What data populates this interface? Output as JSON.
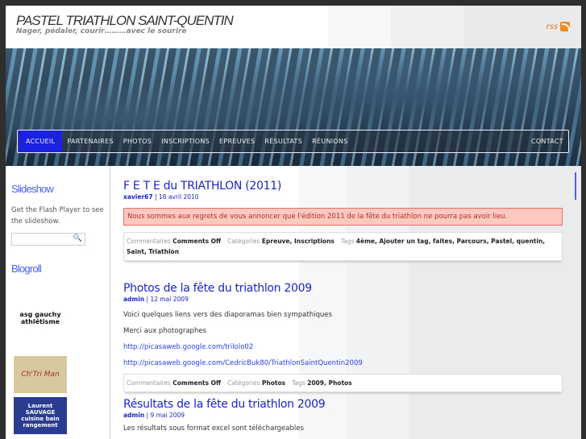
{
  "header": {
    "title": "PASTEL TRIATHLON SAINT-QUENTIN",
    "tagline": "Nager, pédaler, courir………avec le sourire",
    "rss": "rss"
  },
  "nav": [
    "ACCUEIL",
    "PARTENAIRES",
    "PHOTOS",
    "INSCRIPTIONS",
    "EPREUVES",
    "RÉSULTATS",
    "RÉUNIONS",
    "CONTACT"
  ],
  "sidebar": {
    "slideshow_title": "Slideshow",
    "slideshow_text": "Get the Flash Player to see the slideshow.",
    "search_placeholder": "",
    "blogroll_title": "Blogroll",
    "logos": [
      "asg gauchy athlétisme",
      "Ch'Tri Man",
      "Laurent SAUVAGE cuisine bain rangement"
    ]
  },
  "labels": {
    "comments": "Commentaires",
    "categories": "Catégories",
    "tags": "Tags"
  },
  "posts": [
    {
      "title": "F E T E du TRIATHLON (2011)",
      "author": "xavier67",
      "date": "18 avril 2010",
      "alert": "Nous sommes aux regrets de vous annoncer que l'édition 2011 de la fête du triathlon ne pourra pas avoir lieu.",
      "comments": "Comments Off",
      "categories": "Epreuve, Inscriptions",
      "tags": "4ème, Ajouter un tag, faites, Parcours, Pastel, quentin, Saint, Triathlon"
    },
    {
      "title": "Photos de la fête du triathlon 2009",
      "author": "admin",
      "date": "12 mai 2009",
      "p1": "Voici quelques liens vers des diaporamas bien sympathiques",
      "p2": "Merci aux photographes",
      "link1": "http://picasaweb.google.com/trilolo02",
      "link2": "http://picasaweb.google.com/CedricBuk80/TriathlonSaintQuentin2009",
      "comments": "Comments Off",
      "categories": "Photos",
      "tags": "2009, Photos"
    },
    {
      "title": "Résultats de la fête du triathlon 2009",
      "author": "admin",
      "date": "9 mai 2009",
      "p1": "Les résultats sous format excel sont téléchargeables"
    }
  ]
}
